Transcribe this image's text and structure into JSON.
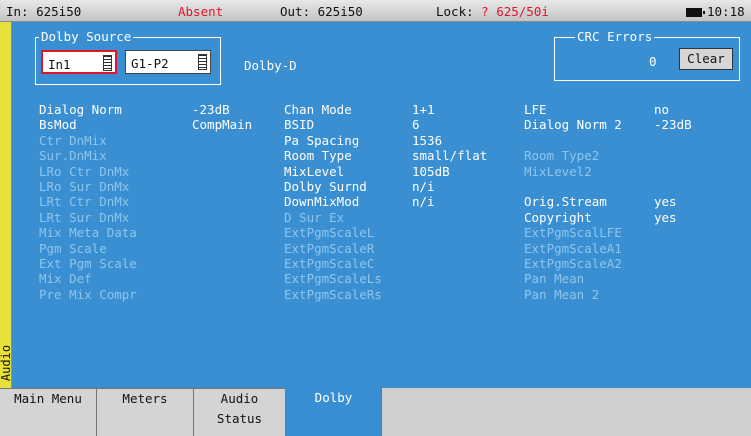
{
  "status": {
    "input": "In: 625i50",
    "presence": "Absent",
    "output": "Out: 625i50",
    "lock_label": "Lock: ",
    "lock_value": "? 625/50i",
    "time": "10:18",
    "colors": {
      "alert": "#e0152a",
      "panel": "#3a8fd2",
      "side_tab": "#e6e23a"
    },
    "icons": [
      "battery-icon"
    ]
  },
  "side_tab": {
    "label": "Audio"
  },
  "dolby_source": {
    "title": "Dolby Source",
    "input_value": "In1",
    "group_value": "G1-P2",
    "format": "Dolby-D"
  },
  "crc": {
    "title": "CRC Errors",
    "count": "0",
    "clear_label": "Clear"
  },
  "params": [
    {
      "col1_label": "Dialog Norm",
      "col1_value": "-23dB",
      "col1_dim": false,
      "col2_label": "Chan Mode",
      "col2_value": "1+1",
      "col2_dim": false,
      "col3_label": "LFE",
      "col3_value": "no",
      "col3_dim": false
    },
    {
      "col1_label": "BsMod",
      "col1_value": "CompMain",
      "col1_dim": false,
      "col2_label": "BSID",
      "col2_value": "6",
      "col2_dim": false,
      "col3_label": "Dialog Norm 2",
      "col3_value": "-23dB",
      "col3_dim": false
    },
    {
      "col1_label": "Ctr DnMix",
      "col1_value": "",
      "col1_dim": true,
      "col2_label": "Pa Spacing",
      "col2_value": "1536",
      "col2_dim": false,
      "col3_label": "",
      "col3_value": "",
      "col3_dim": true
    },
    {
      "col1_label": "Sur.DnMix",
      "col1_value": "",
      "col1_dim": true,
      "col2_label": "Room Type",
      "col2_value": "small/flat",
      "col2_dim": false,
      "col3_label": "Room Type2",
      "col3_value": "",
      "col3_dim": true
    },
    {
      "col1_label": "LRo Ctr DnMx",
      "col1_value": "",
      "col1_dim": true,
      "col2_label": "MixLevel",
      "col2_value": "105dB",
      "col2_dim": false,
      "col3_label": "MixLevel2",
      "col3_value": "",
      "col3_dim": true
    },
    {
      "col1_label": "LRo Sur DnMx",
      "col1_value": "",
      "col1_dim": true,
      "col2_label": "Dolby Surnd",
      "col2_value": "n/i",
      "col2_dim": false,
      "col3_label": "",
      "col3_value": "",
      "col3_dim": true
    },
    {
      "col1_label": "LRt Ctr DnMx",
      "col1_value": "",
      "col1_dim": true,
      "col2_label": "DownMixMod",
      "col2_value": "n/i",
      "col2_dim": false,
      "col3_label": "Orig.Stream",
      "col3_value": "yes",
      "col3_dim": false
    },
    {
      "col1_label": "LRt Sur DnMx",
      "col1_value": "",
      "col1_dim": true,
      "col2_label": "D Sur Ex",
      "col2_value": "",
      "col2_dim": true,
      "col3_label": "Copyright",
      "col3_value": "yes",
      "col3_dim": false
    },
    {
      "col1_label": "Mix Meta Data",
      "col1_value": "",
      "col1_dim": true,
      "col2_label": "ExtPgmScaleL",
      "col2_value": "",
      "col2_dim": true,
      "col3_label": "ExtPgmScalLFE",
      "col3_value": "",
      "col3_dim": true
    },
    {
      "col1_label": "Pgm Scale",
      "col1_value": "",
      "col1_dim": true,
      "col2_label": "ExtPgmScaleR",
      "col2_value": "",
      "col2_dim": true,
      "col3_label": "ExtPgmScaleA1",
      "col3_value": "",
      "col3_dim": true
    },
    {
      "col1_label": "Ext Pgm Scale",
      "col1_value": "",
      "col1_dim": true,
      "col2_label": "ExtPgmScaleC",
      "col2_value": "",
      "col2_dim": true,
      "col3_label": "ExtPgmScaleA2",
      "col3_value": "",
      "col3_dim": true
    },
    {
      "col1_label": "Mix Def",
      "col1_value": "",
      "col1_dim": true,
      "col2_label": "ExtPgmScaleLs",
      "col2_value": "",
      "col2_dim": true,
      "col3_label": "Pan Mean",
      "col3_value": "",
      "col3_dim": true
    },
    {
      "col1_label": "Pre Mix Compr",
      "col1_value": "",
      "col1_dim": true,
      "col2_label": "ExtPgmScaleRs",
      "col2_value": "",
      "col2_dim": true,
      "col3_label": "Pan Mean 2",
      "col3_value": "",
      "col3_dim": true
    }
  ],
  "tabs": [
    {
      "line1": "Main Menu",
      "line2": ""
    },
    {
      "line1": "Meters",
      "line2": ""
    },
    {
      "line1": "Audio",
      "line2": "Status"
    },
    {
      "line1": "Dolby",
      "line2": ""
    }
  ]
}
